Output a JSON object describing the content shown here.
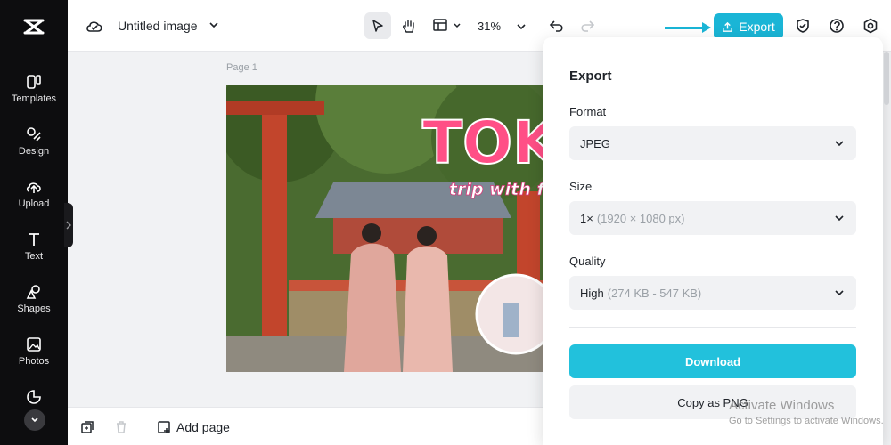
{
  "app": {
    "document_title": "Untitled image",
    "zoom": "31%",
    "export_label": "Export",
    "page_label": "Page 1",
    "add_page_label": "Add page"
  },
  "sidebar": {
    "items": [
      {
        "label": "Templates",
        "icon": "templates-icon"
      },
      {
        "label": "Design",
        "icon": "design-icon"
      },
      {
        "label": "Upload",
        "icon": "upload-icon"
      },
      {
        "label": "Text",
        "icon": "text-icon"
      },
      {
        "label": "Shapes",
        "icon": "shapes-icon"
      },
      {
        "label": "Photos",
        "icon": "photos-icon"
      }
    ]
  },
  "canvas": {
    "title_text": "TOK",
    "subtitle_text": "trip with f"
  },
  "export_panel": {
    "title": "Export",
    "format": {
      "label": "Format",
      "value": "JPEG"
    },
    "size": {
      "label": "Size",
      "value": "1×",
      "detail": "(1920 × 1080 px)"
    },
    "quality": {
      "label": "Quality",
      "value": "High",
      "detail": "(274 KB - 547 KB)"
    },
    "download_label": "Download",
    "copy_label": "Copy as PNG"
  },
  "watermark": {
    "line1": "Activate Windows",
    "line2": "Go to Settings to activate Windows."
  },
  "colors": {
    "accent": "#1ab5d6",
    "sidebar_bg": "#0d0d0f",
    "title_pink": "#ff4f86"
  }
}
